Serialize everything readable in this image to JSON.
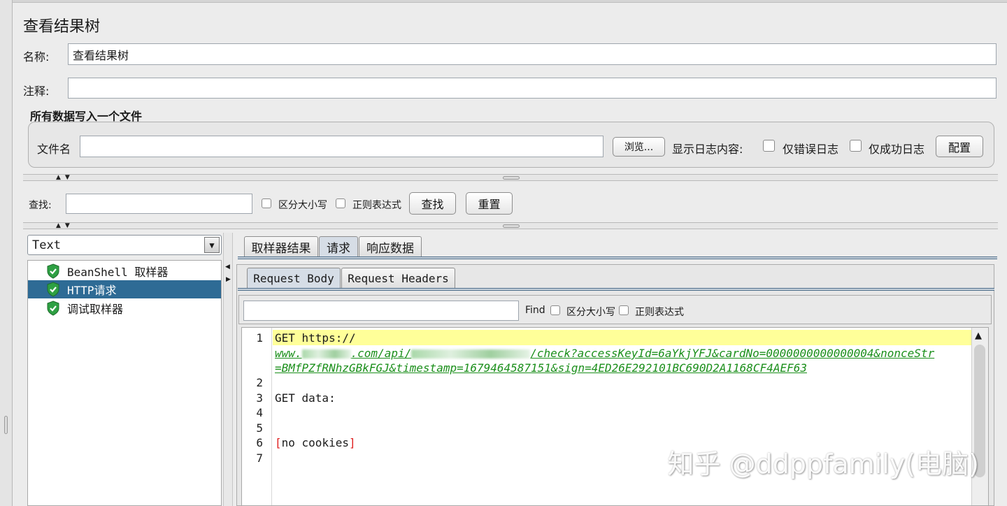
{
  "panel": {
    "title": "查看结果树",
    "name_label": "名称:",
    "name_value": "查看结果树",
    "comment_label": "注释:",
    "comment_value": ""
  },
  "file_section": {
    "heading": "所有数据写入一个文件",
    "filename_label": "文件名",
    "filename_value": "",
    "browse_button": "浏览...",
    "log_display_label": "显示日志内容:",
    "errors_only_label": "仅错误日志",
    "errors_only_checked": false,
    "success_only_label": "仅成功日志",
    "success_only_checked": false,
    "configure_button": "配置"
  },
  "search": {
    "label": "查找:",
    "value": "",
    "case_sensitive_label": "区分大小写",
    "case_sensitive_checked": false,
    "regex_label": "正则表达式",
    "regex_checked": false,
    "find_button": "查找",
    "reset_button": "重置"
  },
  "renderer": {
    "selected": "Text"
  },
  "tree": {
    "items": [
      {
        "label": "BeanShell 取样器",
        "status": "success",
        "selected": false
      },
      {
        "label": "HTTP请求",
        "status": "success",
        "selected": true
      },
      {
        "label": "调试取样器",
        "status": "success",
        "selected": false
      }
    ]
  },
  "result_tabs": {
    "tabs": [
      "取样器结果",
      "请求",
      "响应数据"
    ],
    "active": "请求"
  },
  "request_tabs": {
    "tabs": [
      "Request Body",
      "Request Headers"
    ],
    "active": "Request Body"
  },
  "find_bar": {
    "value": "",
    "find_label": "Find",
    "case_sensitive_label": "区分大小写",
    "regex_label": "正则表达式"
  },
  "editor": {
    "lines": [
      {
        "n": "1",
        "method": "GET https://"
      },
      {
        "n": "",
        "url_a": "www.",
        "url_b": ".com/api/",
        "url_c": "/check?accessKeyId=6aYkjYFJ&cardNo=0000000000000004&nonceStr"
      },
      {
        "n": "",
        "url_d": "=BMfPZfRNhzGBkFGJ&timestamp=1679464587151&sign=4ED26E292101BC690D2A1168CF4AEF63"
      },
      {
        "n": "2",
        "text": ""
      },
      {
        "n": "3",
        "text": "GET data:"
      },
      {
        "n": "4",
        "text": ""
      },
      {
        "n": "5",
        "text": ""
      },
      {
        "n": "6",
        "bracket_open": "[",
        "text": "no cookies",
        "bracket_close": "]"
      },
      {
        "n": "7",
        "text": ""
      }
    ]
  },
  "watermark": "知乎 @ddppfamily(电脑)",
  "colors": {
    "selection": "#2e6b95",
    "url_green": "#1b8f1b",
    "highlight_line": "#ffff99",
    "bracket_red": "#e02020",
    "success_icon": "#2ea043"
  },
  "icons": {
    "tree_status": "shield-check-icon",
    "combo_arrow": "triangle-down-icon"
  }
}
